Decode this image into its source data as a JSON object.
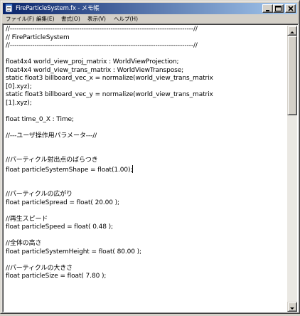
{
  "window": {
    "title": "FireParticleSystem.fx - メモ帳",
    "minimize_glyph": "_",
    "maximize_glyph": "□",
    "close_glyph": "✕"
  },
  "menu": [
    {
      "label": "ファイル(F)"
    },
    {
      "label": "編集(E)"
    },
    {
      "label": "書式(O)"
    },
    {
      "label": "表示(V)"
    },
    {
      "label": "ヘルプ(H)"
    }
  ],
  "editor": {
    "lines": [
      "//----------------------------------------------------------------------------------//",
      "// FireParticleSystem",
      "//----------------------------------------------------------------------------------//",
      "",
      "float4x4 world_view_proj_matrix : WorldViewProjection;",
      "float4x4 world_view_trans_matrix : WorldViewTranspose;",
      "static float3 billboard_vec_x = normalize(world_view_trans_matrix",
      "[0].xyz);",
      "static float3 billboard_vec_y = normalize(world_view_trans_matrix",
      "[1].xyz);",
      "",
      "float time_0_X : Time;",
      "",
      "//---ユーザ操作用パラメータ---//",
      "",
      "",
      "//パーティクル射出点のばらつき",
      "float particleSystemShape = float(1.00);",
      "",
      "",
      "//パーティクルの広がり",
      "float particleSpread = float( 20.00 );",
      "",
      "//再生スピード",
      "float particleSpeed = float( 0.48 );",
      "",
      "//全体の高さ",
      "float particleSystemHeight = float( 80.00 );",
      "",
      "//パーティクルの大きさ",
      "float particleSize = float( 7.80 );",
      "",
      "",
      "",
      ""
    ],
    "caret_line": 17
  }
}
